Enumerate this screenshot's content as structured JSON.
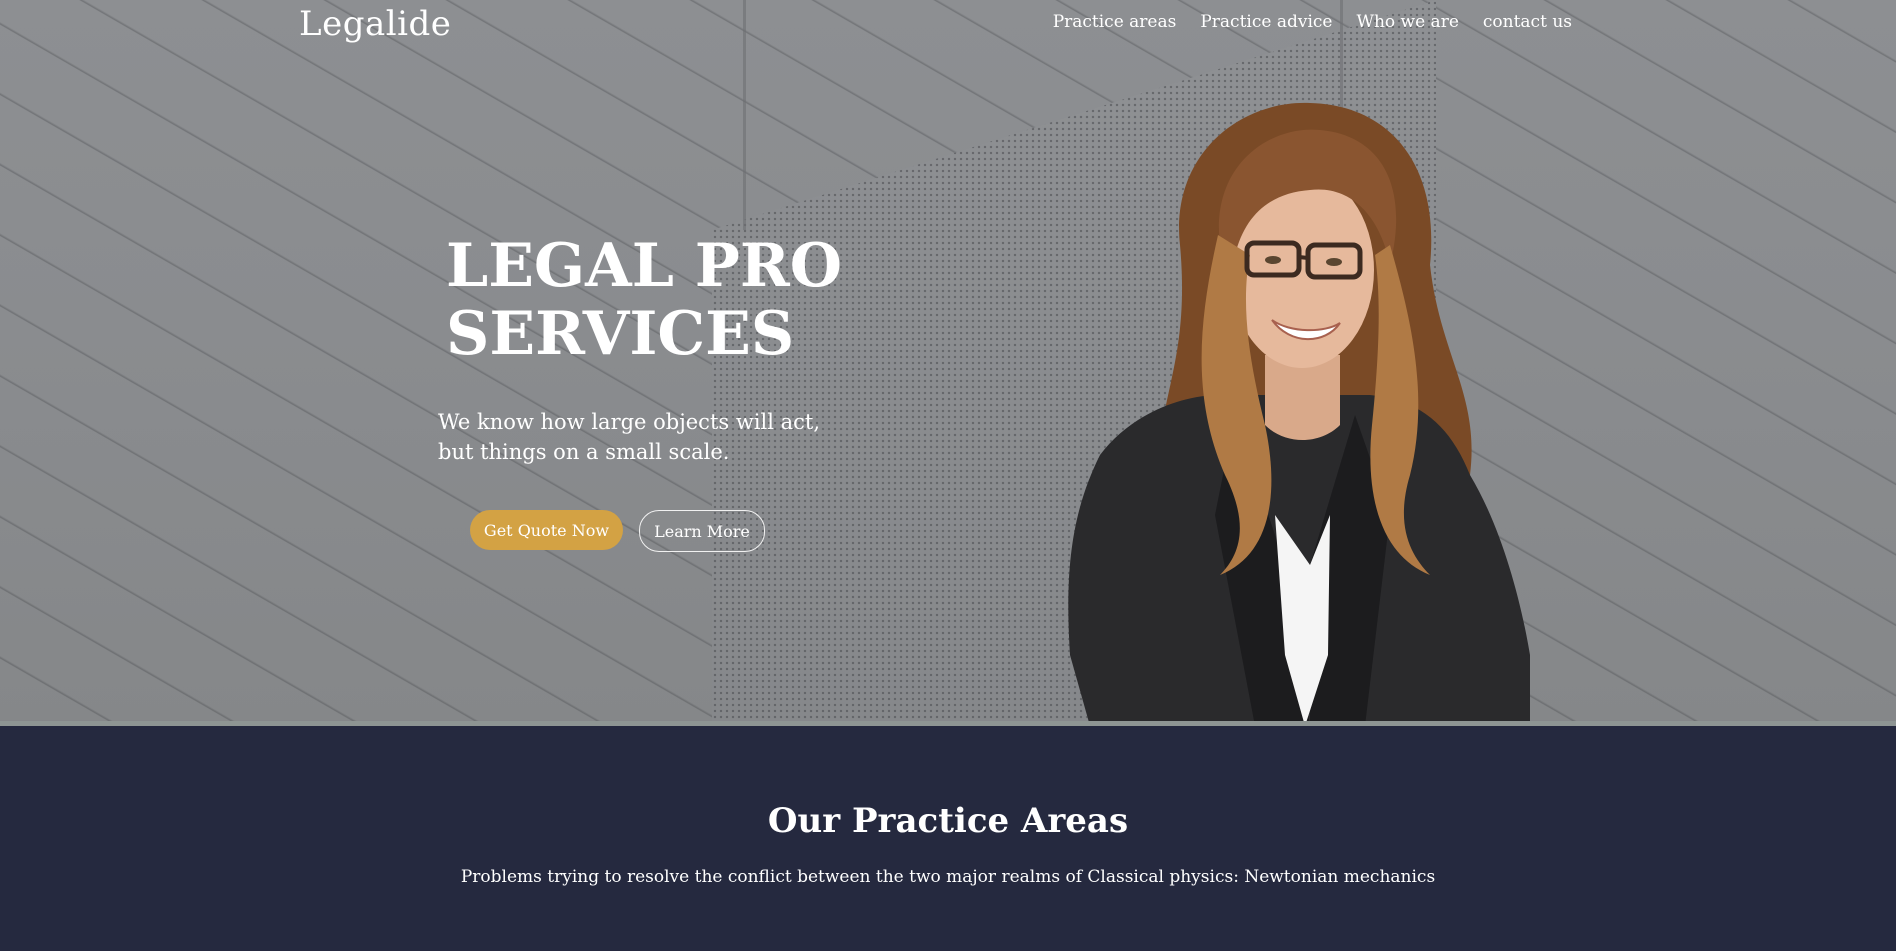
{
  "header": {
    "logo": "Legalide",
    "nav": [
      {
        "label": "Practice areas"
      },
      {
        "label": "Practice advice"
      },
      {
        "label": "Who we are"
      },
      {
        "label": "contact us"
      }
    ]
  },
  "hero": {
    "headline_line1": "LEGAL PRO",
    "headline_line2": "SERVICES",
    "subtext_line1": "We know how large objects will act,",
    "subtext_line2": "but things on a small scale.",
    "primary_button": "Get Quote Now",
    "secondary_button": "Learn More",
    "portrait_image": "smiling-woman-with-glasses-in-black-blazer"
  },
  "practice": {
    "title": "Our Practice Areas",
    "subtitle": "Problems trying to resolve the conflict between the two major realms of Classical physics: Newtonian mechanics"
  },
  "colors": {
    "accent": "#d3a244",
    "navy": "#25293f",
    "hero_gray": "#8b8d90"
  }
}
